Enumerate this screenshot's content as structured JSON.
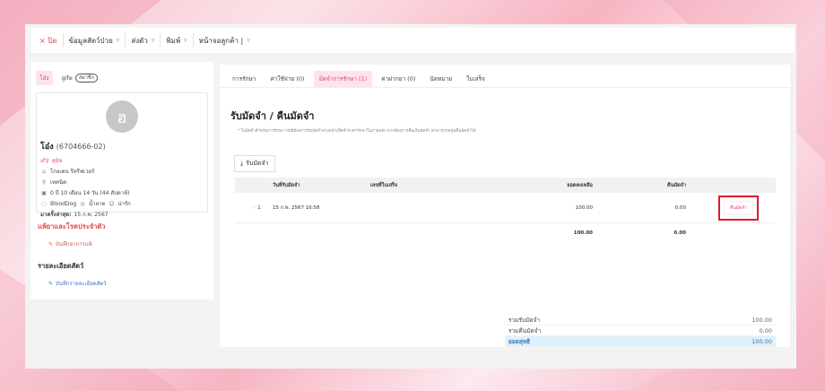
{
  "topbar": {
    "close": "× ปิด",
    "items": [
      {
        "label": "ข้อมูลสัตว์ป่วย",
        "chev": "▿"
      },
      {
        "label": "ส่งตัว",
        "chev": "▿"
      },
      {
        "label": "พิมพ์",
        "chev": "▿"
      },
      {
        "label": "หน้าจอลูกค้า |",
        "chev": "▿"
      }
    ]
  },
  "left": {
    "tab_active": "โอ๋ง",
    "tab_other": "gife",
    "tab_other_badge": "สมาชิก",
    "avatar_letter": "ฮ",
    "pet_name": "โอ๋ง",
    "pet_code": "(6704666-02)",
    "sex_icon": "♂♀",
    "sex": "สุนัข",
    "breed": "โกลเดน รีทรีฟเวอร์",
    "location": "เทคนิค",
    "age": "0 ปี 10 เดือน 14 วัน (44 สัปดาห์)",
    "blood": "BloodDog",
    "weight": "น้ำลาด",
    "status": "น่ารัก",
    "last_visit_label": "มาครั้งล่าสุด:",
    "last_visit": "15 ก.พ. 2567",
    "section_allergy": "แพ้ยาและโรคประจำตัว",
    "link_allergy": "บันทึกอาการแพ้",
    "section_details": "รายละเอียดสัตว์",
    "link_details": "บันทึกรายละเอียดสัตว์"
  },
  "right": {
    "tabs": [
      "การรักษา",
      "ค่าใช้จ่าย (0)",
      "มัดจำการรักษา (1)",
      "ค่าฝากยา (0)",
      "นัดหมาย",
      "ใบเสร็จ"
    ],
    "active_tab": 2,
    "title": "รับมัดจำ / คืนมัดจำ",
    "subtitle": "* ใบมัดจำสำหรับการรักษา กรณีต้องการรับมัดจำล่วงหน้าเพื่อชำระค่ารักษาในภายหลัง หากต้องการคืนเงินมัดจำ สามารถกดปุ่มคืนมัดจำได้",
    "add_button": "รับมัดจำ",
    "table": {
      "headers": [
        "",
        "",
        "วันที่รับมัดจำ",
        "เลขที่ใบเสร็จ",
        "ยอดคงเหลือ",
        "คืนมัดจำ",
        ""
      ],
      "rows": [
        {
          "expand": "›",
          "no": "1",
          "date": "15 ก.พ. 2567 16:58",
          "receipt": "",
          "balance": "100.00",
          "refund": "0.00",
          "action": "คืนมัดจำ"
        }
      ],
      "footer": {
        "balance": "100.00",
        "refund": "0.00"
      }
    },
    "summary": [
      {
        "label": "รวมรับมัดจำ",
        "value": "100.00"
      },
      {
        "label": "รวมคืนมัดจำ",
        "value": "0.00"
      },
      {
        "label": "ยอดสุทธิ",
        "value": "100.00"
      }
    ]
  }
}
